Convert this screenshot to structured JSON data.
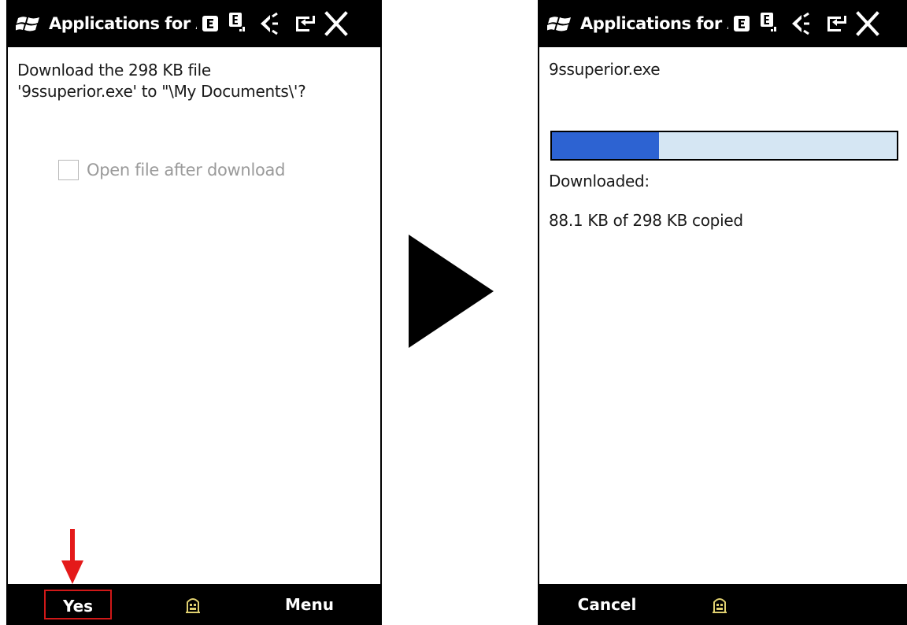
{
  "colors": {
    "bar_background": "#000000",
    "progress_fill": "#2d63d2",
    "progress_track": "#d5e6f3",
    "highlight": "#d01818",
    "disabled_text": "#9a9a9a"
  },
  "left_screen": {
    "title": "Applications for Ac",
    "status_icons": [
      "windows-logo-icon",
      "e-network-icon",
      "e-signal-icon",
      "speaker-icon",
      "battery-icon",
      "close-icon"
    ],
    "message": "Download the 298 KB file '9ssuperior.exe' to \"\\My Documents\\'?",
    "checkbox": {
      "label": "Open file after download",
      "checked": false,
      "enabled": false
    },
    "softkeys": {
      "left": "Yes",
      "right": "Menu",
      "center_icon": "keyboard-icon"
    }
  },
  "right_screen": {
    "title": "Applications for Ac",
    "filename": "9ssuperior.exe",
    "progress_fraction": 0.31,
    "downloaded_label": "Downloaded:",
    "copied_text": "88.1 KB of 298 KB copied",
    "softkeys": {
      "left": "Cancel",
      "center_icon": "keyboard-icon"
    }
  }
}
